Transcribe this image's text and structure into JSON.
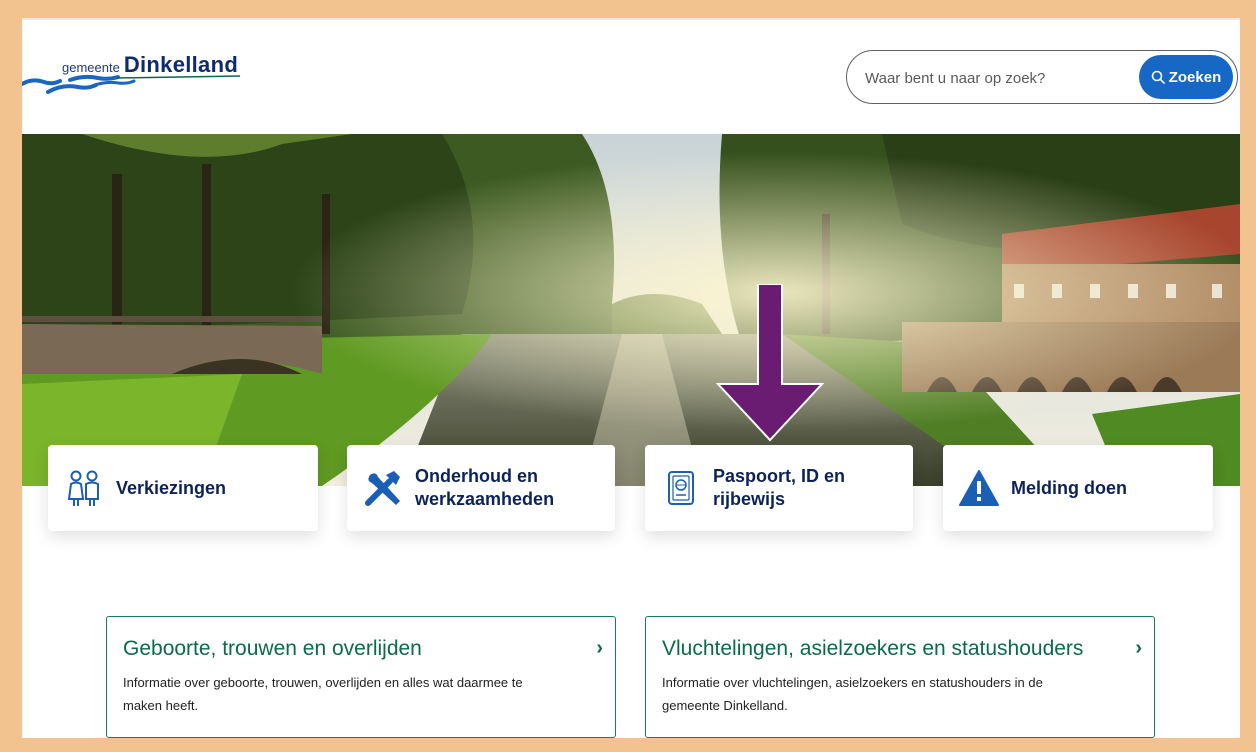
{
  "header": {
    "logo_small": "gemeente",
    "logo_big": "Dinkelland",
    "search_placeholder": "Waar bent u naar op zoek?",
    "search_button": "Zoeken"
  },
  "colors": {
    "brand_navy": "#0f2a6e",
    "button_blue": "#1668c4",
    "card_green": "#0b6b48",
    "arrow_purple": "#6a1b72",
    "frame_border": "#f3c38f"
  },
  "tiles": [
    {
      "label_line1": "Verkiezingen",
      "label_line2": "",
      "icon": "people-icon"
    },
    {
      "label_line1": "Onderhoud en",
      "label_line2": "werkzaamheden",
      "icon": "tools-icon"
    },
    {
      "label_line1": "Paspoort, ID en",
      "label_line2": "rijbewijs",
      "icon": "passport-icon"
    },
    {
      "label_line1": "Melding doen",
      "label_line2": "",
      "icon": "warning-icon"
    }
  ],
  "cards": [
    {
      "title": "Geboorte, trouwen en overlijden",
      "desc_line1": "Informatie over geboorte, trouwen, overlijden en alles wat daarmee te",
      "desc_line2": "maken heeft."
    },
    {
      "title": "Vluchtelingen, asielzoekers en statushouders",
      "desc_line1": "Informatie over vluchtelingen, asielzoekers en statushouders in de",
      "desc_line2": "gemeente Dinkelland."
    }
  ],
  "chevron": "›"
}
